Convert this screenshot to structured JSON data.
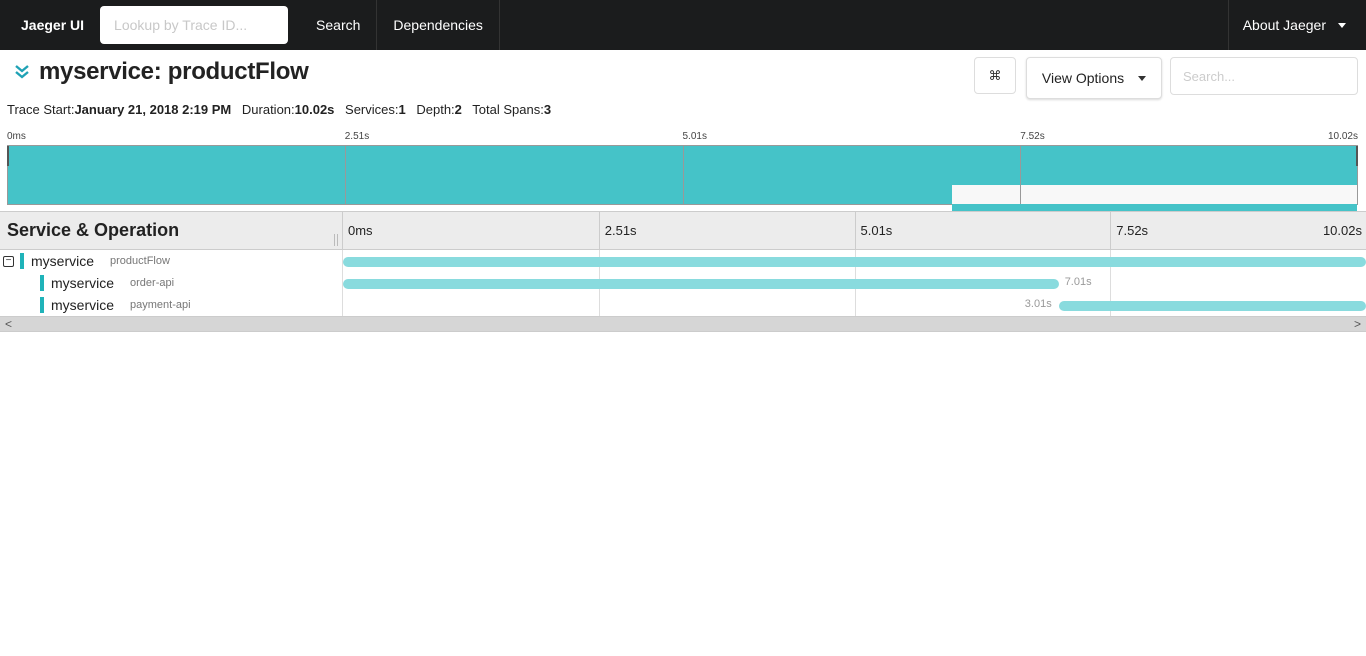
{
  "nav": {
    "brand": "Jaeger UI",
    "lookup_placeholder": "Lookup by Trace ID...",
    "search": "Search",
    "dependencies": "Dependencies",
    "about": "About Jaeger"
  },
  "trace": {
    "title": "myservice: productFlow",
    "collapse_icon": "double-chevron-down-icon",
    "meta": {
      "trace_start_label": "Trace Start:",
      "trace_start": "January 21, 2018 2:19 PM",
      "duration_label": "Duration:",
      "duration": "10.02s",
      "services_label": "Services:",
      "services": "1",
      "depth_label": "Depth:",
      "depth": "2",
      "total_spans_label": "Total Spans:",
      "total_spans": "3"
    },
    "actions": {
      "keyboard_shortcuts_icon": "⌘",
      "view_options": "View Options",
      "search_placeholder": "Search..."
    }
  },
  "minimap": {
    "ticks": [
      "0ms",
      "2.51s",
      "5.01s",
      "7.52s",
      "10.02s"
    ],
    "total_s": 10.02,
    "spans": [
      {
        "start_s": 0,
        "end_s": 10.02
      },
      {
        "start_s": 0,
        "end_s": 7.01
      },
      {
        "start_s": 7.01,
        "end_s": 10.02
      }
    ]
  },
  "timeline": {
    "header_label": "Service & Operation",
    "ticks": [
      "0ms",
      "2.51s",
      "5.01s",
      "7.52s",
      "10.02s"
    ],
    "total_s": 10.02,
    "colors": {
      "span": "#89dbde",
      "service": "#1fb3b9"
    },
    "spans": [
      {
        "service": "myservice",
        "operation": "productFlow",
        "start_s": 0,
        "duration_s": 10.02,
        "depth": 0,
        "label": "",
        "collapsible": true
      },
      {
        "service": "myservice",
        "operation": "order-api",
        "start_s": 0,
        "duration_s": 7.01,
        "depth": 1,
        "label": "7.01s",
        "label_side": "right"
      },
      {
        "service": "myservice",
        "operation": "payment-api",
        "start_s": 7.01,
        "duration_s": 3.01,
        "depth": 1,
        "label": "3.01s",
        "label_side": "left"
      }
    ],
    "scroll_left": "<",
    "scroll_right": ">"
  }
}
